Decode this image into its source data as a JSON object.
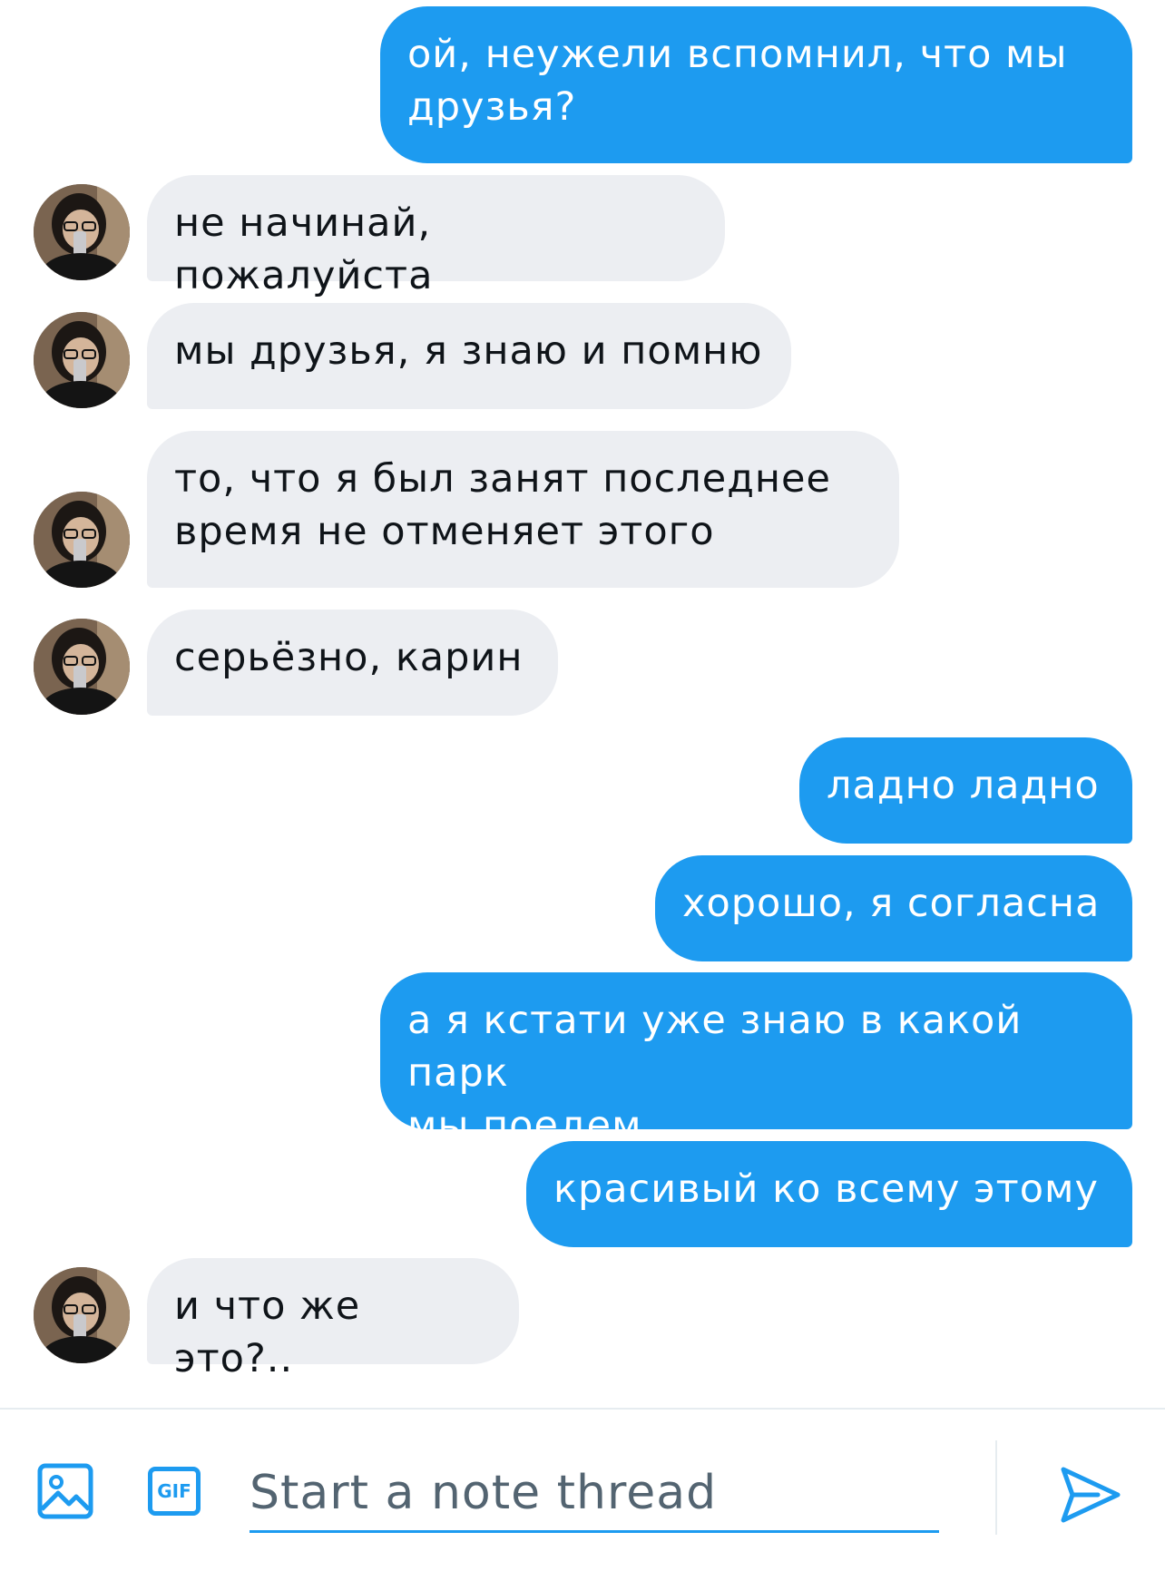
{
  "messages": [
    {
      "from": "me",
      "text": "ой, неужели вспомнил, что мы\nдрузья?"
    },
    {
      "from": "them",
      "text": "не начинай, пожалуйста"
    },
    {
      "from": "them",
      "text": "мы друзья, я знаю и помню"
    },
    {
      "from": "them",
      "text": "то, что я был занят последнее\nвремя не отменяет этого"
    },
    {
      "from": "them",
      "text": "серьёзно, карин"
    },
    {
      "from": "me",
      "text": "ладно ладно"
    },
    {
      "from": "me",
      "text": "хорошо, я согласна"
    },
    {
      "from": "me",
      "text": "а я кстати уже знаю в какой парк\nмы поедем"
    },
    {
      "from": "me",
      "text": "красивый ко всему этому"
    },
    {
      "from": "them",
      "text": "и что же это?.."
    }
  ],
  "composer": {
    "placeholder": "Start a note thread",
    "gif_label": "GIF",
    "accent_color": "#1d9bf0",
    "media_icon": "image-icon",
    "send_icon": "send-icon"
  },
  "colors": {
    "outgoing_bubble": "#1d9bf0",
    "incoming_bubble": "#eceef2",
    "outgoing_text": "#ffffff",
    "incoming_text": "#0f1419"
  }
}
